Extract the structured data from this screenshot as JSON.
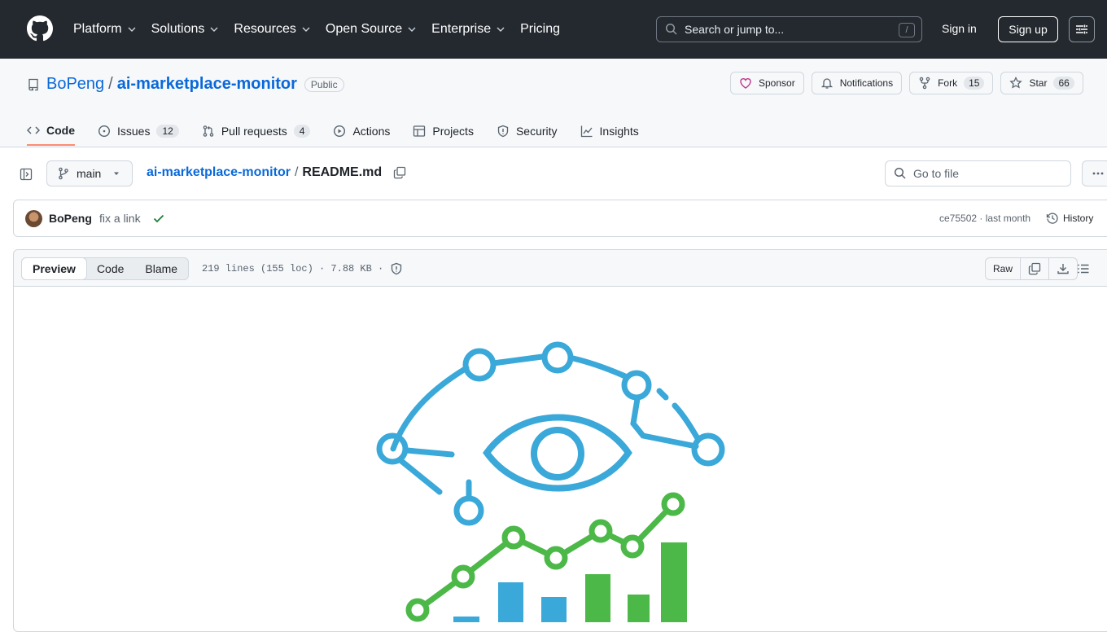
{
  "header": {
    "nav": [
      {
        "label": "Platform",
        "dropdown": true
      },
      {
        "label": "Solutions",
        "dropdown": true
      },
      {
        "label": "Resources",
        "dropdown": true
      },
      {
        "label": "Open Source",
        "dropdown": true
      },
      {
        "label": "Enterprise",
        "dropdown": true
      },
      {
        "label": "Pricing",
        "dropdown": false
      }
    ],
    "search_placeholder": "Search or jump to...",
    "search_shortcut": "/",
    "signin": "Sign in",
    "signup": "Sign up"
  },
  "repo": {
    "owner": "BoPeng",
    "separator": "/",
    "name": "ai-marketplace-monitor",
    "visibility": "Public",
    "actions": {
      "sponsor": "Sponsor",
      "notifications": "Notifications",
      "fork": "Fork",
      "fork_count": "15",
      "star": "Star",
      "star_count": "66"
    },
    "tabs": [
      {
        "label": "Code",
        "count": null,
        "active": true,
        "icon": "code-icon"
      },
      {
        "label": "Issues",
        "count": "12",
        "active": false,
        "icon": "issue-icon"
      },
      {
        "label": "Pull requests",
        "count": "4",
        "active": false,
        "icon": "pull-request-icon"
      },
      {
        "label": "Actions",
        "count": null,
        "active": false,
        "icon": "play-icon"
      },
      {
        "label": "Projects",
        "count": null,
        "active": false,
        "icon": "table-icon"
      },
      {
        "label": "Security",
        "count": null,
        "active": false,
        "icon": "shield-icon"
      },
      {
        "label": "Insights",
        "count": null,
        "active": false,
        "icon": "graph-icon"
      }
    ]
  },
  "file_nav": {
    "branch": "main",
    "breadcrumb_repo": "ai-marketplace-monitor",
    "breadcrumb_sep": "/",
    "file_name": "README.md",
    "goto_placeholder": "Go to file"
  },
  "commit": {
    "author": "BoPeng",
    "message": "fix a link",
    "sha": "ce75502",
    "dot": "·",
    "when": "last month",
    "history": "History"
  },
  "file_view": {
    "modes": [
      "Preview",
      "Code",
      "Blame"
    ],
    "active_mode": "Preview",
    "info": "219 lines (155 loc) · 7.88 KB ·",
    "raw": "Raw"
  },
  "colors": {
    "header_bg": "#24292f",
    "link": "#0969da",
    "tab_underline": "#fd8c73",
    "eye_blue": "#3aa8d8",
    "chart_green": "#4cb848"
  }
}
